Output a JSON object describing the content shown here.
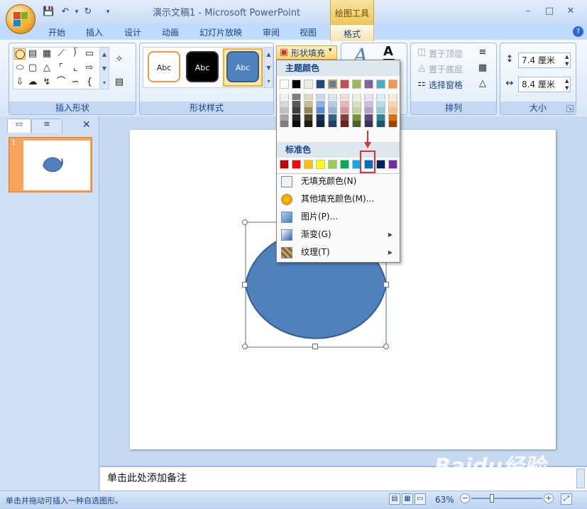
{
  "window": {
    "title": "演示文稿1 - Microsoft PowerPoint",
    "tools_context": "绘图工具"
  },
  "tabs": [
    {
      "label": "开始"
    },
    {
      "label": "插入"
    },
    {
      "label": "设计"
    },
    {
      "label": "动画"
    },
    {
      "label": "幻灯片放映"
    },
    {
      "label": "审阅"
    },
    {
      "label": "视图"
    },
    {
      "label": "格式",
      "active": true
    }
  ],
  "ribbon": {
    "groups": {
      "insert_shapes": "插入形状",
      "shape_styles": "形状样式",
      "arrange": "排列",
      "size": "大小"
    },
    "style_samples": [
      "Abc",
      "Abc",
      "Abc"
    ],
    "shape_fill_button": "形状填充",
    "arrange": {
      "bring_front": "置于顶层",
      "send_back": "置于底层",
      "selection_pane": "选择窗格"
    },
    "size": {
      "height": "7.4 厘米",
      "width": "8.4 厘米"
    }
  },
  "dropdown": {
    "theme_colors_title": "主题颜色",
    "standard_colors_title": "标准色",
    "theme_top_row": [
      "#FFFFFF",
      "#000000",
      "#EEECE1",
      "#1F497D",
      "#4F81BD",
      "#C0504D",
      "#9BBB59",
      "#8064A2",
      "#4BACC6",
      "#F79646"
    ],
    "theme_shade_columns": [
      [
        "#F2F2F2",
        "#D8D8D8",
        "#BFBFBF",
        "#A5A5A5",
        "#7F7F7F"
      ],
      [
        "#7F7F7F",
        "#595959",
        "#3F3F3F",
        "#262626",
        "#0C0C0C"
      ],
      [
        "#DDD9C3",
        "#C4BD97",
        "#938953",
        "#494429",
        "#1D1B10"
      ],
      [
        "#C6D9F0",
        "#8DB3E2",
        "#548DD4",
        "#17365D",
        "#0F243E"
      ],
      [
        "#DBE5F1",
        "#B8CCE4",
        "#95B3D7",
        "#366092",
        "#244061"
      ],
      [
        "#F2DCDB",
        "#E5B9B7",
        "#D99694",
        "#953734",
        "#632423"
      ],
      [
        "#EBF1DD",
        "#D7E3BC",
        "#C3D69B",
        "#76923C",
        "#4F6128"
      ],
      [
        "#E5E0EC",
        "#CCC1D9",
        "#B2A2C7",
        "#5F497A",
        "#3F3151"
      ],
      [
        "#DBEEF3",
        "#B7DDE8",
        "#92CDDC",
        "#31859B",
        "#205867"
      ],
      [
        "#FDEADA",
        "#FBD5B5",
        "#FAC08F",
        "#E36C09",
        "#974806"
      ]
    ],
    "standard_colors": [
      "#C00000",
      "#FF0000",
      "#FFC000",
      "#FFFF00",
      "#92D050",
      "#00B050",
      "#00B0F0",
      "#0070C0",
      "#002060",
      "#7030A0"
    ],
    "items": {
      "no_fill": "无填充颜色(N)",
      "more_colors": "其他填充颜色(M)...",
      "picture": "图片(P)...",
      "gradient": "渐变(G)",
      "texture": "纹理(T)"
    }
  },
  "shape": {
    "fill": "#4F81BD",
    "stroke": "#385D8A"
  },
  "left_pane": {
    "slide_number": "1"
  },
  "notes_placeholder": "单击此处添加备注",
  "status": {
    "text": "单击并拖动可插入一种自选图形。",
    "zoom": "63%"
  },
  "watermark": "Baidu经验"
}
